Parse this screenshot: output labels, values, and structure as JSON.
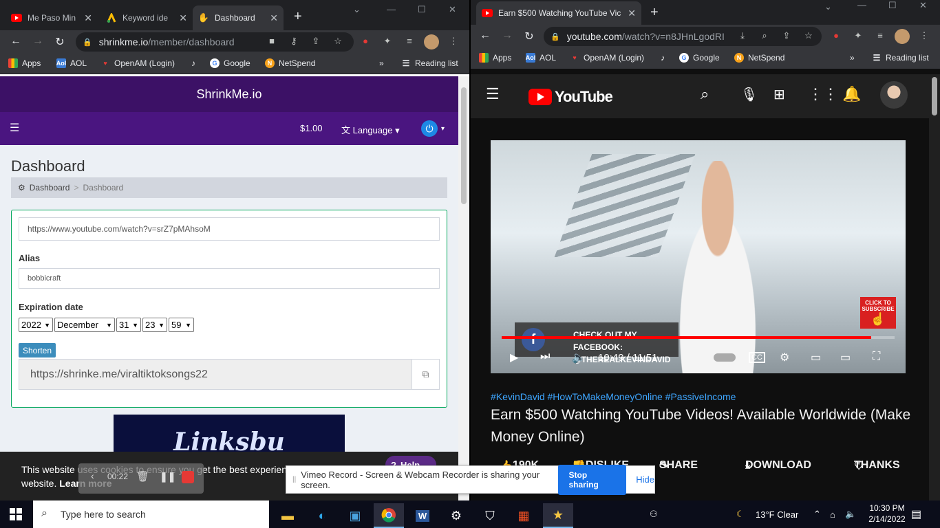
{
  "left_browser": {
    "tabs": [
      {
        "title": "Me Paso Min",
        "icon": "youtube-icon"
      },
      {
        "title": "Keyword ide",
        "icon": "google-ads-icon"
      },
      {
        "title": "Dashboard",
        "icon": "shrinkme-icon",
        "active": true
      }
    ],
    "url_host": "shrinkme.io",
    "url_path": "/member/dashboard",
    "bookmarks": [
      "Apps",
      "AOL",
      "OpenAM (Login)",
      "Google",
      "NetSpend"
    ],
    "reading_list": "Reading list"
  },
  "shrinkme": {
    "brand": "ShrinkMe.io",
    "balance": "$1.00",
    "language": "Language",
    "page_title": "Dashboard",
    "breadcrumb": [
      "Dashboard",
      "Dashboard"
    ],
    "long_url_value": "https://www.youtube.com/watch?v=srZ7pMAhsoM",
    "alias_label": "Alias",
    "alias_value": "bobbicraft",
    "expiration_label": "Expiration date",
    "expiration": {
      "year": "2022",
      "month": "December",
      "day": "31",
      "hour": "23",
      "minute": "59"
    },
    "shorten_button": "Shorten",
    "short_url": "https://shrinke.me/viraltiktoksongs22",
    "banner_text": "Linksbu",
    "cookie_text": "This website uses cookies to ensure you get the best experience on our",
    "cookie_text2": "website.",
    "learn_more": "Learn more",
    "help": "Help"
  },
  "recorder": {
    "time": "00:22"
  },
  "right_browser": {
    "tabs": [
      {
        "title": "Earn $500 Watching YouTube Vic",
        "icon": "youtube-icon",
        "active": true
      }
    ],
    "url_host": "youtube.com",
    "url_path": "/watch?v=n8JHnLgodRI",
    "bookmarks": [
      "Apps",
      "AOL",
      "OpenAM (Login)",
      "Google",
      "NetSpend"
    ],
    "reading_list": "Reading list"
  },
  "youtube": {
    "logo": "YouTube",
    "overlay_line1": "CHECK OUT MY FACEBOOK:",
    "overlay_line2": "@THEREALKEVINDAVID",
    "subscribe_badge": "CLICK TO SUBSCRIBE",
    "time": "10:49 / 11:51",
    "progress_fraction": 0.94,
    "hashtags": "#KevinDavid #HowToMakeMoneyOnline #PassiveIncome",
    "title": "Earn $500 Watching YouTube Videos! Available Worldwide (Make Money Online)",
    "actions": [
      "190K",
      "DISLIKE",
      "SHARE",
      "DOWNLOAD",
      "THANKS"
    ]
  },
  "share_bar": {
    "text": "Vimeo Record - Screen & Webcam Recorder is sharing your screen.",
    "stop": "Stop sharing",
    "hide": "Hide"
  },
  "taskbar": {
    "search_placeholder": "Type here to search",
    "weather": "13°F  Clear",
    "time": "10:30 PM",
    "date": "2/14/2022"
  }
}
